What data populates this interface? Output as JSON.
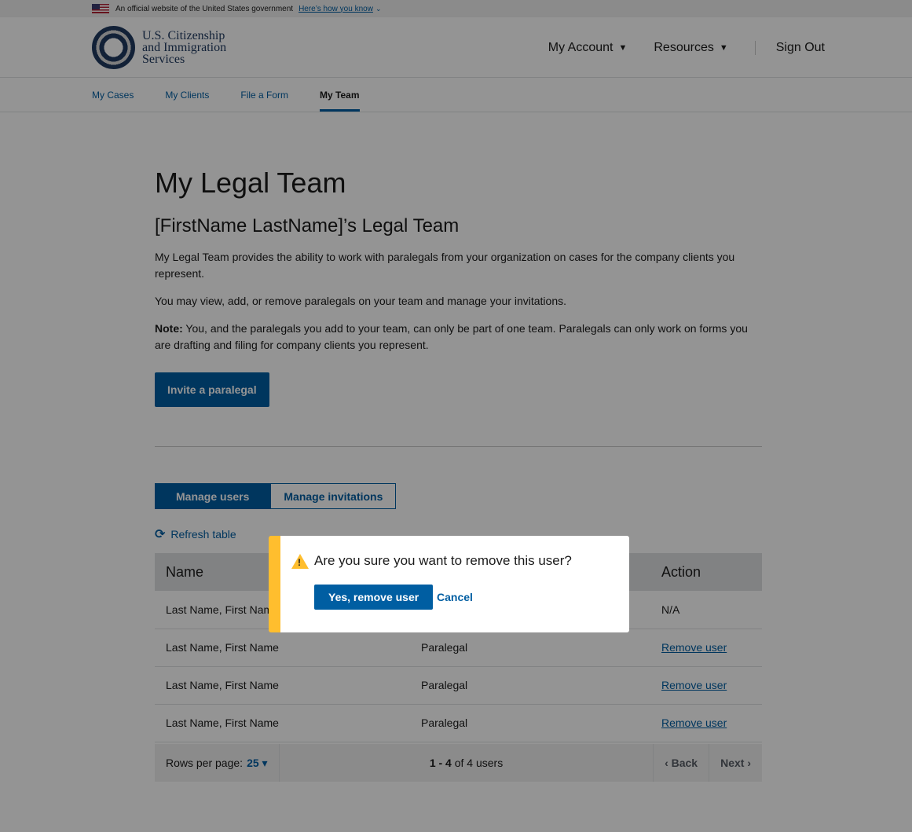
{
  "gov_banner": {
    "text": "An official website of the United States government",
    "link": "Here’s how you know",
    "chevron": "⌄"
  },
  "header": {
    "agency_line1": "U.S. Citizenship",
    "agency_line2": "and Immigration",
    "agency_line3": "Services",
    "nav": {
      "account": "My Account",
      "resources": "Resources",
      "sign_out": "Sign Out",
      "caret": "▼"
    }
  },
  "sub_nav": [
    "My Cases",
    "My Clients",
    "File a Form",
    "My Team"
  ],
  "main": {
    "title": "My Legal Team",
    "team_title": "[FirstName LastName]’s Legal Team",
    "para1": "My Legal Team provides the ability to work with paralegals from your organization on cases for the company clients you represent.",
    "para2": "You may view, add, or remove paralegals on your team and manage your invitations.",
    "note_label": "Note:",
    "note_text": " You, and the paralegals you add to your team, can only be part of one team. Paralegals can only work on forms you are drafting and filing for company clients you represent.",
    "invite_button": "Invite a paralegal"
  },
  "segmented": {
    "manage_users": "Manage users",
    "manage_invitations": "Manage invitations"
  },
  "refresh": {
    "icon": "⟳",
    "label": "Refresh table"
  },
  "table": {
    "headers": {
      "name": "Name",
      "role": "",
      "action": "Action"
    },
    "rows": [
      {
        "name": "Last Name, First Name",
        "role": "",
        "action": "N/A"
      },
      {
        "name": "Last Name, First Name",
        "role": "Paralegal",
        "action": "Remove user"
      },
      {
        "name": "Last Name, First Name",
        "role": "Paralegal",
        "action": "Remove user"
      },
      {
        "name": "Last Name, First Name",
        "role": "Paralegal",
        "action": "Remove user"
      }
    ]
  },
  "pager": {
    "rows_label": "Rows per page:",
    "rows_value": "25",
    "caret": "▾",
    "count_range": "1 - 4",
    "count_rest": " of 4 users",
    "back": "‹  Back",
    "next": "Next  ›"
  },
  "modal": {
    "warn_glyph": "!",
    "question": "Are you sure you want to remove this user?",
    "confirm": "Yes, remove user",
    "cancel": "Cancel"
  },
  "colors": {
    "primary": "#005ea2",
    "warning": "#ffbe2e",
    "overlay": "rgba(0,0,0,0.42)"
  }
}
